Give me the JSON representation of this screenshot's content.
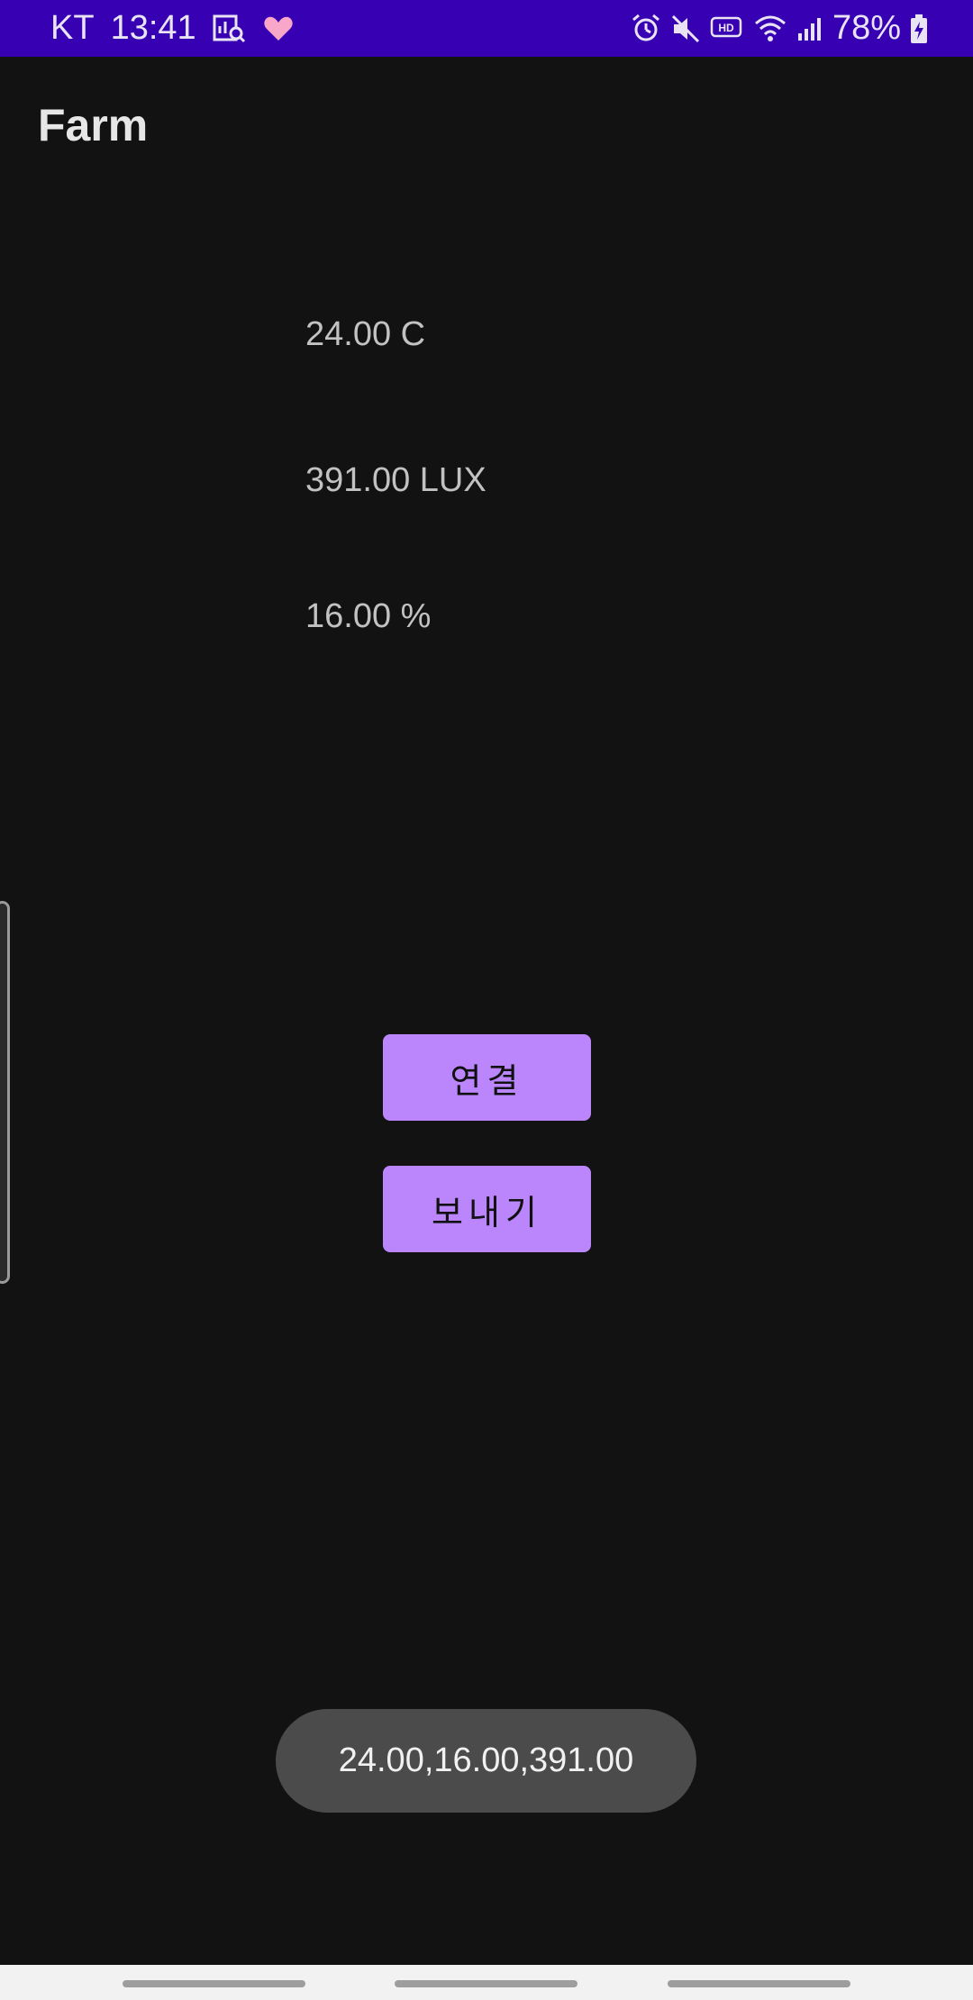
{
  "status_bar": {
    "carrier": "KT",
    "time": "13:41",
    "battery_percent": "78%",
    "left_icons": [
      "gallery-search-icon",
      "heart-icon"
    ],
    "right_icons": [
      "alarm-icon",
      "mute-icon",
      "hd-icon",
      "wifi-icon",
      "signal-icon",
      "battery-charging-icon"
    ],
    "background_color": "#3700B3"
  },
  "app_bar": {
    "title": "Farm"
  },
  "readings": {
    "temperature": "24.00 C",
    "illuminance": "391.00 LUX",
    "humidity": "16.00 %"
  },
  "buttons": {
    "connect_label": "연결",
    "send_label": "보내기",
    "color": "#BB86FC"
  },
  "toast": {
    "message": "24.00,16.00,391.00"
  },
  "colors": {
    "background": "#121212",
    "accent": "#BB86FC"
  }
}
